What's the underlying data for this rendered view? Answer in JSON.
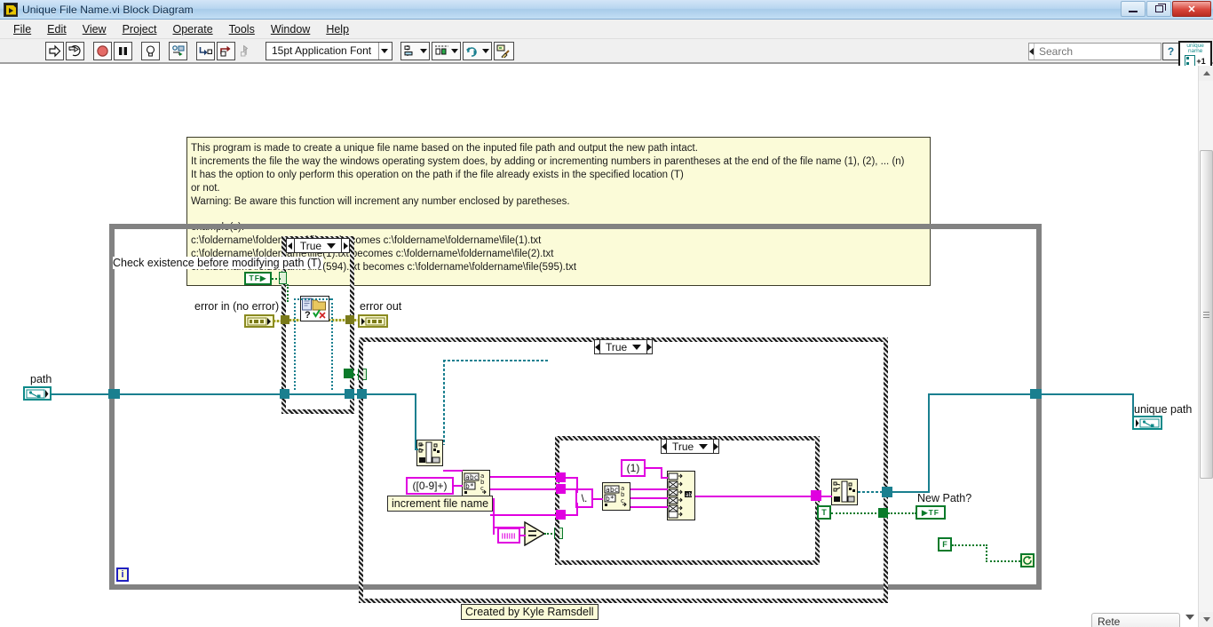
{
  "window": {
    "title": "Unique File Name.vi Block Diagram",
    "app_icon": "labview-vi-icon",
    "buttons": {
      "minimize": "–",
      "restore": "❐",
      "close": "✕"
    }
  },
  "menu": {
    "items": [
      "File",
      "Edit",
      "View",
      "Project",
      "Operate",
      "Tools",
      "Window",
      "Help"
    ]
  },
  "toolbar": {
    "buttons": [
      {
        "name": "run-button",
        "glyph": "run-arrow-icon"
      },
      {
        "name": "run-continuously-button",
        "glyph": "run-continuous-icon"
      },
      {
        "name": "abort-execution-button",
        "glyph": "abort-stop-icon"
      },
      {
        "name": "pause-button",
        "glyph": "pause-icon"
      },
      {
        "name": "highlight-execution-button",
        "glyph": "lightbulb-icon"
      },
      {
        "name": "retain-wire-values-button",
        "glyph": "retain-wire-values-icon"
      },
      {
        "name": "step-into-button",
        "glyph": "step-into-icon"
      },
      {
        "name": "step-over-button",
        "glyph": "step-over-icon"
      },
      {
        "name": "step-out-button",
        "glyph": "step-out-icon"
      }
    ],
    "font_selector": "15pt Application Font",
    "align_objects": "align-objects-icon",
    "distribute_objects": "distribute-objects-icon",
    "resize_objects": "reorder-objects-icon",
    "clean_up_diagram": "clean-up-diagram-icon",
    "vi_icon_label": "unique name",
    "vi_icon_badge": "+1"
  },
  "search": {
    "placeholder": "Search",
    "icon": "magnifier-icon"
  },
  "help": {
    "icon": "question-mark-icon"
  },
  "documentation": {
    "lines": [
      "This program is made to create a unique file name based on the inputed file path and output the new path intact.",
      "It increments the file the way the windows operating system does, by adding or incrementing numbers in parentheses at the end of the file name (1), (2), ... (n)",
      "It has the option to only perform this operation on the path if the file already exists in the specified location (T)",
      "or not.",
      "Warning: Be aware this function will increment any number enclosed by paretheses.",
      "",
      "example(s):",
      "c:\\foldername\\foldername\\file.txt becomes c:\\foldername\\foldername\\file(1).txt",
      "c:\\foldername\\foldername\\file(1).txt becomes c:\\foldername\\foldername\\file(2).txt",
      "c:\\foldername\\foldername\\file(594).txt becomes c:\\foldername\\foldername\\file(595).txt"
    ]
  },
  "diagram": {
    "labels": {
      "check_existence": "Check existence before modifying path (T)",
      "error_in": "error in (no error)",
      "error_out": "error out",
      "path": "path",
      "unique_path": "unique path",
      "new_path": "New Path?",
      "increment_file_name": "increment file name",
      "created_by": "Created by Kyle Ramsdell"
    },
    "terminals": {
      "check_existence_value": "TF",
      "error_in_value": "err",
      "error_out_value": "err",
      "path_value": "path-ctrl-icon",
      "unique_path_value": "path-ind-icon",
      "new_path_value": "TF"
    },
    "case_structures": [
      {
        "name": "outer-case-file-exists",
        "selector": "True"
      },
      {
        "name": "middle-case-increment",
        "selector": "True"
      },
      {
        "name": "inner-case-has-number",
        "selector": "True"
      }
    ],
    "constants": [
      {
        "name": "regex-constant",
        "value": "([0-9]+)"
      },
      {
        "name": "paren-one-constant",
        "value": "(1)"
      },
      {
        "name": "backslash-constant",
        "value": "\\."
      },
      {
        "name": "empty-string-constant",
        "value": ""
      },
      {
        "name": "true-constant",
        "value": "T"
      },
      {
        "name": "false-constant",
        "value": "F"
      }
    ],
    "nodes": [
      {
        "name": "check-if-file-folder-exists-vi",
        "icon": "file-folder-question-icon"
      },
      {
        "name": "path-to-string-node",
        "icon": "path-to-string-icon"
      },
      {
        "name": "match-pattern-node-1",
        "icon": "match-pattern-icon"
      },
      {
        "name": "match-pattern-node-2",
        "icon": "match-pattern-icon"
      },
      {
        "name": "concatenate-strings-node",
        "icon": "concatenate-strings-icon"
      },
      {
        "name": "equal-comparison-node",
        "icon": "equals-icon"
      },
      {
        "name": "string-to-path-node",
        "icon": "string-to-path-icon"
      },
      {
        "name": "string-to-path-node-2",
        "icon": "string-to-path-icon"
      },
      {
        "name": "context-help-indicator",
        "icon": "info-i-icon"
      },
      {
        "name": "loop-condition-terminal",
        "icon": "loop-stop-icon"
      }
    ]
  },
  "taskbar": {
    "item": "Rete"
  }
}
